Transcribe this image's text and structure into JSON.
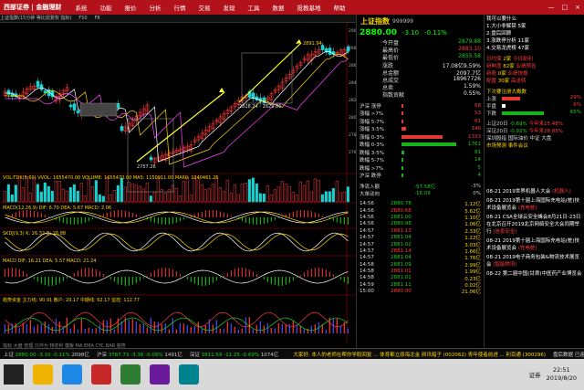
{
  "app": {
    "brand": "西部证券 | 金融理财",
    "menu": [
      "系统",
      "功能",
      "报价",
      "分析",
      "行情",
      "交易",
      "发现",
      "工具",
      "数据",
      "投教基地",
      "帮助"
    ],
    "window_buttons": [
      "—",
      "□",
      "×"
    ]
  },
  "toolbar2": {
    "items": [
      "上证指数(15分钟 等比前复权 指标)",
      "F10",
      "F8"
    ]
  },
  "chart": {
    "title": "上证指数(15分钟 等比前复权 指标)",
    "price_labels": {
      "high": "2891.94",
      "mid": "2828.24 - 2829.86",
      "low": "2757.26"
    },
    "indicators": [
      {
        "label": "VOL-TDX(5,60)  VVOL: 1655470.00  VOLUME: 1655470.00  MA5: 1150911.00  MA60: 1240461.25"
      },
      {
        "label": "MACD(12,26,9)  DIF: 6.70  DEA: 5.67  MACD: 2.06"
      },
      {
        "label": "SKDJ(9,3)  K: 26.32  D: 26.88"
      },
      {
        "label": "MACD DIF: 16.21  DEA: 5.57  MACD: 21.24"
      },
      {
        "label": "趋势资金  主力线: 90.91  散户: 20.17  中期线: 62.17  监控: 112.77"
      }
    ],
    "right_axis": [
      "2900",
      "2880",
      "2860",
      "2840",
      "2820",
      "2800",
      "2780",
      "2760"
    ],
    "tabs": [
      "指标",
      "大盘",
      "管理",
      "只作为",
      "特定利",
      "模板",
      "MA",
      "EMA",
      "CYC",
      "BAR",
      "趋势"
    ]
  },
  "quote": {
    "name": "上证指数",
    "code": "999999",
    "price": "2880.00",
    "change": "-3.10",
    "change_pct": "-0.11%",
    "rows": [
      {
        "k": "今开盘",
        "v": "2879.88",
        "color": "green"
      },
      {
        "k": "最高价",
        "v": "2883.10",
        "color": "red"
      },
      {
        "k": "最低价",
        "v": "2855.58",
        "color": "green"
      },
      {
        "k": "涨跌",
        "v": "17.08亿9.59%",
        "color": "normal"
      },
      {
        "k": "总金额",
        "v": "2097.7亿",
        "color": "normal"
      },
      {
        "k": "总成交",
        "v": "18967726",
        "color": "normal"
      },
      {
        "k": "总卖",
        "v": "1.59%",
        "color": "normal"
      },
      {
        "k": "指数贡献",
        "v": "0.55%",
        "color": "normal"
      }
    ],
    "sector_hdr": "沪深 涨停",
    "distribution": [
      {
        "k": "沪深 涨停",
        "v": "68",
        "color": "red"
      },
      {
        "k": "涨幅 >7%",
        "v": "53",
        "color": "red"
      },
      {
        "k": "涨幅 5-7%",
        "v": "61",
        "color": "red"
      },
      {
        "k": "涨幅 3-5%",
        "v": "146",
        "color": "red"
      },
      {
        "k": "涨幅 0-3%",
        "v": "1333",
        "color": "red"
      },
      {
        "k": "跌幅 0-3%",
        "v": "1761",
        "color": "green"
      },
      {
        "k": "跌幅 3-5%",
        "v": "81",
        "color": "green"
      },
      {
        "k": "跌幅 5-7%",
        "v": "14",
        "color": "green"
      },
      {
        "k": "跌幅 >7%",
        "v": "5",
        "color": "green"
      },
      {
        "k": "沪深 跌停",
        "v": "4",
        "color": "green"
      }
    ],
    "netflow": [
      {
        "k": "净流入额",
        "v": "-57.58亿",
        "pct": "-3%"
      },
      {
        "k": "大单动向",
        "v": "-16.09",
        "pct": "0%"
      }
    ],
    "ticks": [
      {
        "t": "14:56",
        "p": "2880.78",
        "v": "1.12亿"
      },
      {
        "t": "14:56",
        "p": "2880.68",
        "v": "5.62亿"
      },
      {
        "t": "14:56",
        "p": "2881.00",
        "v": "1.10亿"
      },
      {
        "t": "14:56",
        "p": "2880.98",
        "v": "1.06亿"
      },
      {
        "t": "14:57",
        "p": "2881.13",
        "v": "2.33亿"
      },
      {
        "t": "14:57",
        "p": "2881.04",
        "v": "1.22亿"
      },
      {
        "t": "14:57",
        "p": "2881.02",
        "v": "3.03亿"
      },
      {
        "t": "14:57",
        "p": "2881.14",
        "v": "1.66亿"
      },
      {
        "t": "14:57",
        "p": "2881.04",
        "v": "1.76亿"
      },
      {
        "t": "14:58",
        "p": "2881.09",
        "v": "2.99亿"
      },
      {
        "t": "14:58",
        "p": "2881.01",
        "v": "1.99亿"
      },
      {
        "t": "14:58",
        "p": "2881.01",
        "v": "0.23亿"
      },
      {
        "t": "14:59",
        "p": "2881.11",
        "v": "0.02亿"
      },
      {
        "t": "15:00",
        "p": "2880.00",
        "v": "21.06亿"
      }
    ]
  },
  "info": {
    "title": "我可以要什么",
    "lines": [
      "1.大小非解禁 5家",
      "2.盘后回顾",
      "3.涨跌停分析 11家",
      "4.交易龙虎榜 47家"
    ],
    "stats": [
      {
        "k": "日均保",
        "v": "2家",
        "v2": "今日耐利"
      },
      {
        "k": "新鲜度",
        "v": "82家",
        "v2": "业绩预告"
      },
      {
        "k": "新股",
        "v": "0家",
        "v2": "业绩快报"
      },
      {
        "k": "配置",
        "v": "30家",
        "v2": "高送转"
      }
    ],
    "sector_title": "下次要注册大概数",
    "sector_rows": [
      {
        "k": "上涨",
        "pct": "29%"
      },
      {
        "k": "平盘",
        "pct": "6%"
      },
      {
        "k": "下跌",
        "pct": "65%"
      }
    ],
    "index_rows": [
      {
        "k": "上证20日",
        "v": "-0.69%",
        "v2": "今年来15.48%"
      },
      {
        "k": "深证20日",
        "v": "-0.92%",
        "v2": "今年来28.85%"
      }
    ],
    "more": "深圳股指 国际油价 中证 大盘",
    "events_title": "市场预测 事件会议",
    "news": [
      {
        "date": "08-21",
        "text": "2019世界机器人大会",
        "tag": "(机器人)"
      },
      {
        "date": "08-21",
        "text": "2019第十届上海国际充电站(桩)技术设备展览会",
        "tag": "(充电桩)"
      },
      {
        "date": "08-21",
        "text": "CSA全球云安全峰会8月21日-23日在北京召开2019北京网络安全大会同期举行",
        "tag": "(信息安全)"
      },
      {
        "date": "08-21",
        "text": "2019第十届上海国际充电站(桩)技术设备展览会",
        "tag": "(充电桩)"
      },
      {
        "date": "08-21",
        "text": "2019电子商务包装&物流技术展览会",
        "tag": "(智能物流)"
      },
      {
        "date": "08-22",
        "text": "第二届中国(甘肃)中医药产业博览会",
        "tag": ""
      }
    ]
  },
  "status": {
    "items": [
      {
        "t": "上证",
        "v": "2880.00",
        "c": "-3.10",
        "p": "-0.11%",
        "a": "2098亿"
      },
      {
        "t": "沪深",
        "v": "3787.73",
        "c": "-3.36",
        "p": "-0.09%",
        "a": "1491亿"
      },
      {
        "t": "深证",
        "v": "1611.59",
        "c": "-11.25",
        "p": "-0.69%",
        "a": "1074亿"
      }
    ],
    "ticker": "大家好: 本人的老师在帮你学股回复 ... 体育都立原海北金 网讯暗子 (002062) 青年使者前进 ... 利百通 (300296)",
    "right": "盘后数据   已连接"
  },
  "taskbar": {
    "time": "22:51",
    "date": "2019/8/20",
    "tray": "证券"
  }
}
